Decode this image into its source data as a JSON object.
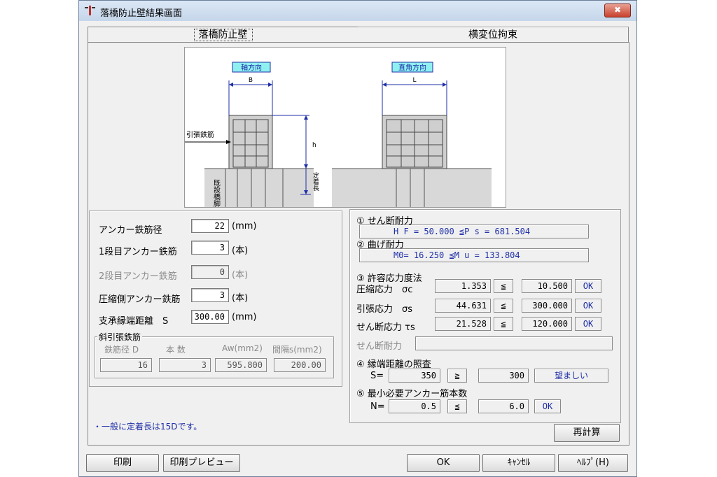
{
  "window": {
    "title": "落橋防止壁結果画面",
    "close_label": "✖"
  },
  "tabs": [
    {
      "label": "落橋防止壁"
    },
    {
      "label": "横変位拘束"
    }
  ],
  "diagram": {
    "left_title": "軸方向",
    "right_title": "直角方向",
    "dim_b": "B",
    "dim_l": "L",
    "dim_h": "h",
    "rebar_label": "引張鉄筋",
    "pier_label": "既設橋脚",
    "anchor_label": "定着長"
  },
  "inputs": {
    "anchor_dia": {
      "label": "アンカー鉄筋径",
      "value": "22",
      "unit": "(mm)"
    },
    "row1": {
      "label": "1段目アンカー鉄筋",
      "value": "3",
      "unit": "(本)"
    },
    "row2": {
      "label": "2段目アンカー鉄筋",
      "value": "0",
      "unit": "(本)"
    },
    "comp": {
      "label": "圧縮側アンカー鉄筋",
      "value": "3",
      "unit": "(本)"
    },
    "edge": {
      "label": "支承縁端距離　S",
      "value": "300.00",
      "unit": "(mm)"
    }
  },
  "oblique": {
    "title": "斜引張鉄筋",
    "headers": [
      "鉄筋径 D",
      "本 数",
      "Aw(mm2)",
      "間隔s(mm2)"
    ],
    "values": [
      "16",
      "3",
      "595.800",
      "200.00"
    ]
  },
  "results": {
    "shear": {
      "title": "① せん断耐力",
      "text": "H F =  50.000 ≦P s =  681.504"
    },
    "bend": {
      "title": "② 曲げ耐力",
      "text": "M0=  16.250 ≦M u =  133.804"
    },
    "allow": {
      "title": "③ 許容応力度法",
      "rows": [
        {
          "label": "圧縮応力　σc",
          "value": "1.353",
          "op": "≦",
          "limit": "10.500",
          "status": "OK"
        },
        {
          "label": "引張応力　σs",
          "value": "44.631",
          "op": "≦",
          "limit": "300.000",
          "status": "OK"
        },
        {
          "label": "せん断応力 τs",
          "value": "21.528",
          "op": "≦",
          "limit": "120.000",
          "status": "OK"
        }
      ],
      "shear_cap_label": "せん断耐力",
      "shear_cap_value": ""
    },
    "edge": {
      "title": "④ 縁端距離の照査",
      "prefix": "S=",
      "value": "350",
      "op": "≧",
      "limit": "300",
      "status": "望ましい"
    },
    "min_anchor": {
      "title": "⑤ 最小必要アンカー筋本数",
      "prefix": "N=",
      "value": "0.5",
      "op": "≦",
      "limit": "6.0",
      "status": "OK"
    }
  },
  "note": "・一般に定着長は15Dです。",
  "buttons": {
    "recalc": "再計算",
    "print": "印刷",
    "preview": "印刷プレビュー",
    "ok": "OK",
    "cancel": "ｷｬﾝｾﾙ",
    "help": "ﾍﾙﾌﾟ(H)"
  },
  "colors": {
    "title_bar": "#c5d6ea",
    "close": "#c8412c",
    "result_text": "#1f2fa8",
    "label_box": "#8ff0f0"
  }
}
